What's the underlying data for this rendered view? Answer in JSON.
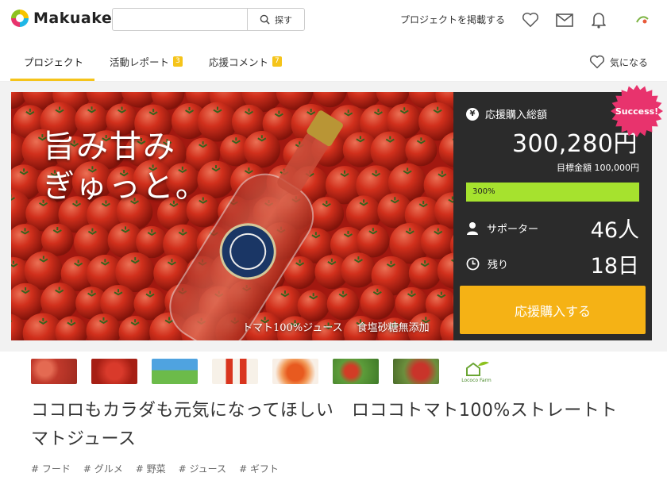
{
  "app": {
    "logo_text": "Makuake"
  },
  "header": {
    "search_placeholder": "",
    "search_label": "探す",
    "post_project": "プロジェクトを掲載する"
  },
  "tabs": [
    {
      "label": "プロジェクト",
      "badge": ""
    },
    {
      "label": "活動レポート",
      "badge": "3"
    },
    {
      "label": "応援コメント",
      "badge": "7"
    }
  ],
  "watch_label": "気になる",
  "hero": {
    "headline_1": "旨み甘み",
    "headline_2": "ぎゅっと。",
    "caption_1": "トマト100%ジュース",
    "caption_2": "食塩砂糖無添加"
  },
  "panel": {
    "total_label": "応援購入総額",
    "amount": "300,280円",
    "goal": "目標金額 100,000円",
    "progress_label": "300%",
    "progress_fraction": 1.0,
    "supporters_label": "サポーター",
    "supporters": "46人",
    "remaining_label": "残り",
    "remaining": "18日",
    "cta": "応援購入する",
    "success_badge": "Success!"
  },
  "thumb_logo_text": "Lococo Farm",
  "title": "ココロもカラダも元気になってほしい　ロココトマト100%ストレートトマトジュース",
  "tags": [
    "# フード",
    "# グルメ",
    "# 野菜",
    "# ジュース",
    "# ギフト"
  ],
  "colors": {
    "accent": "#f5c41a",
    "cta": "#f5b215",
    "progress": "#a6e22e",
    "success": "#e8336d",
    "panel": "#2b2b2b"
  }
}
